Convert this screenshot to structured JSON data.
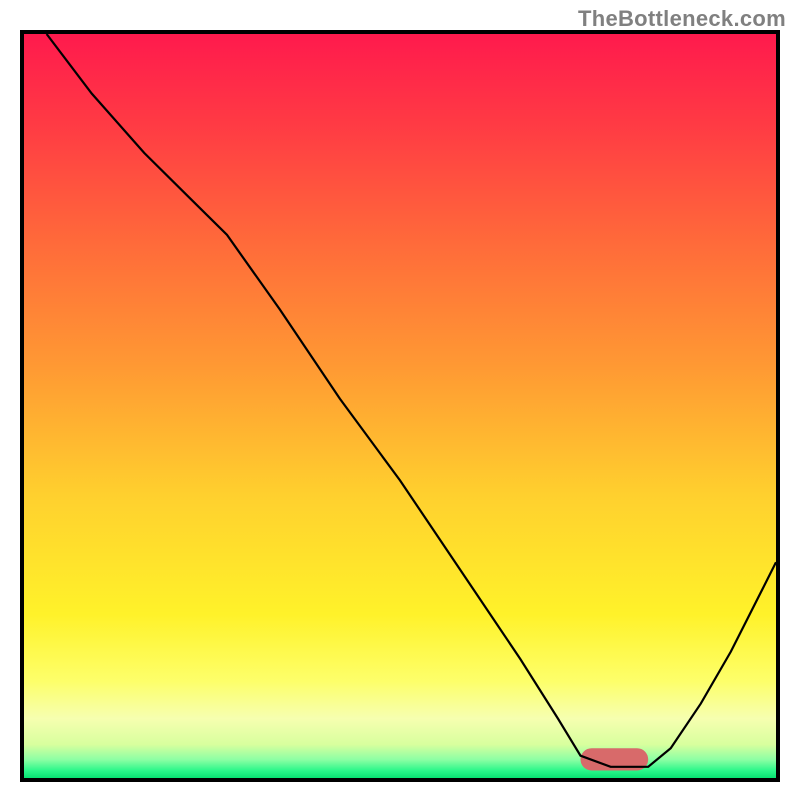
{
  "watermark": "TheBottleneck.com",
  "colors": {
    "gradient_stops": [
      {
        "offset": 0.0,
        "color": "#ff1a4d"
      },
      {
        "offset": 0.12,
        "color": "#ff3a44"
      },
      {
        "offset": 0.28,
        "color": "#ff6a3a"
      },
      {
        "offset": 0.45,
        "color": "#ff9a33"
      },
      {
        "offset": 0.62,
        "color": "#ffd02e"
      },
      {
        "offset": 0.78,
        "color": "#fff22a"
      },
      {
        "offset": 0.87,
        "color": "#fdff6a"
      },
      {
        "offset": 0.92,
        "color": "#f6ffb0"
      },
      {
        "offset": 0.955,
        "color": "#d8ff9e"
      },
      {
        "offset": 0.975,
        "color": "#8effa4"
      },
      {
        "offset": 0.99,
        "color": "#2bf78a"
      },
      {
        "offset": 1.0,
        "color": "#08e272"
      }
    ],
    "marker": "#d86a6a",
    "curve": "#000000"
  },
  "chart_data": {
    "type": "line",
    "title": "",
    "xlabel": "",
    "ylabel": "",
    "xlim": [
      0,
      100
    ],
    "ylim": [
      0,
      100
    ],
    "optimum_range_x": [
      74,
      83
    ],
    "curve_points": [
      {
        "x": 3,
        "y": 100
      },
      {
        "x": 9,
        "y": 92
      },
      {
        "x": 16,
        "y": 84
      },
      {
        "x": 22,
        "y": 78
      },
      {
        "x": 27,
        "y": 73
      },
      {
        "x": 34,
        "y": 63
      },
      {
        "x": 42,
        "y": 51
      },
      {
        "x": 50,
        "y": 40
      },
      {
        "x": 58,
        "y": 28
      },
      {
        "x": 66,
        "y": 16
      },
      {
        "x": 71,
        "y": 8
      },
      {
        "x": 74,
        "y": 3
      },
      {
        "x": 78,
        "y": 1.5
      },
      {
        "x": 83,
        "y": 1.5
      },
      {
        "x": 86,
        "y": 4
      },
      {
        "x": 90,
        "y": 10
      },
      {
        "x": 94,
        "y": 17
      },
      {
        "x": 98,
        "y": 25
      },
      {
        "x": 100,
        "y": 29
      }
    ],
    "marker": {
      "x_start": 74,
      "x_end": 83,
      "y": 2.5,
      "height": 3
    }
  }
}
